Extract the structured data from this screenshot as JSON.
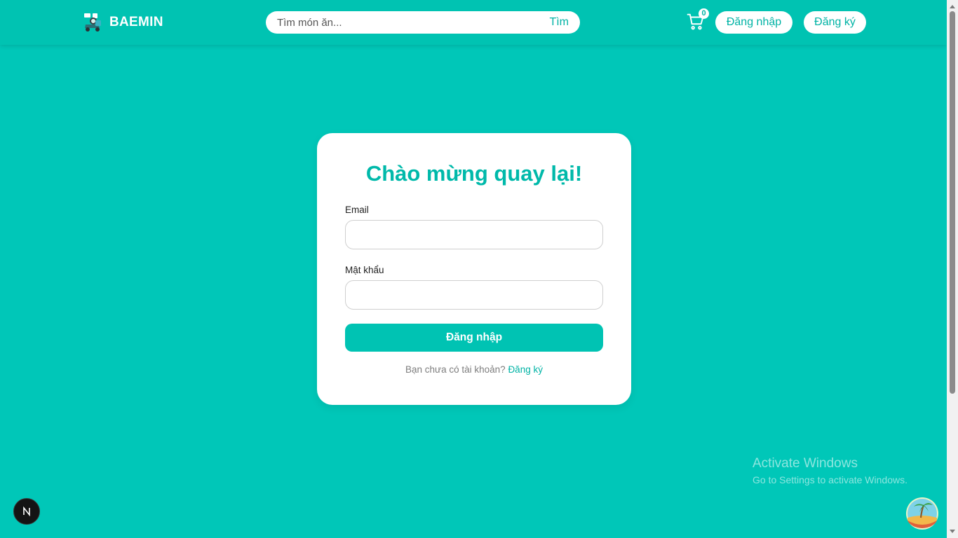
{
  "header": {
    "brand": "BAEMIN",
    "search": {
      "placeholder": "Tìm món ăn...",
      "value": "",
      "button_label": "Tìm"
    },
    "cart_count": "0",
    "login_label": "Đăng nhập",
    "register_label": "Đăng ký"
  },
  "login_form": {
    "title": "Chào mừng quay lại!",
    "email_label": "Email",
    "email_value": "",
    "password_label": "Mật khẩu",
    "password_value": "",
    "submit_label": "Đăng nhập",
    "signup_prompt": "Bạn chưa có tài khoản?",
    "signup_link": "Đăng ký"
  },
  "watermark": {
    "title": "Activate Windows",
    "subtitle": "Go to Settings to activate Windows."
  },
  "icons": {
    "logo": "baemin-scooter-logo",
    "cart": "shopping-cart-icon",
    "dev_badge": "nextjs-icon",
    "floating_button": "tropical-island-icon"
  },
  "colors": {
    "background": "#00c7b8",
    "header": "#00c3b2",
    "accent": "#00b9aa",
    "card": "#ffffff"
  }
}
